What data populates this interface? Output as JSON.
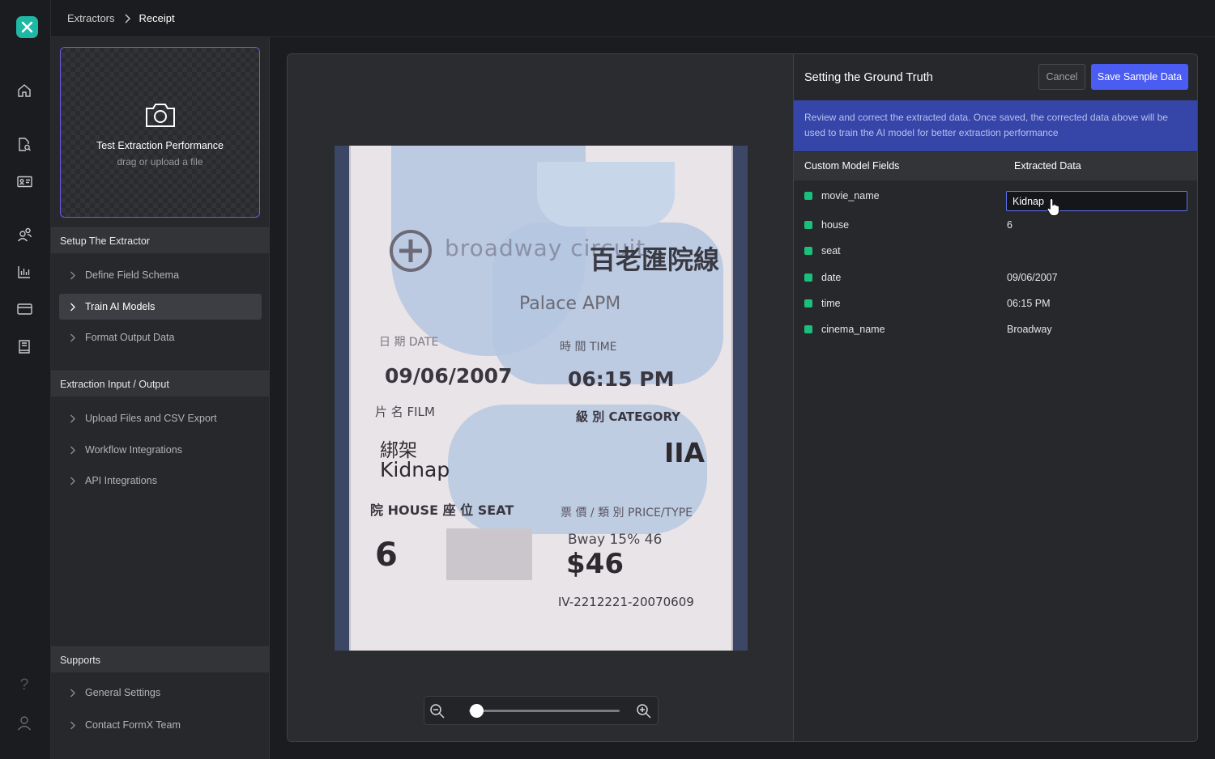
{
  "breadcrumb": {
    "parent": "Extractors",
    "current": "Receipt"
  },
  "rail": {
    "icons": [
      "home-icon",
      "document-search-icon",
      "id-card-icon",
      "users-icon",
      "bar-chart-icon",
      "credit-card-icon",
      "book-icon",
      "help-icon",
      "user-icon"
    ],
    "help_glyph": "?"
  },
  "upload": {
    "title": "Test Extraction Performance",
    "subtitle": "drag or upload a file"
  },
  "sidebar": {
    "setup": {
      "title": "Setup The Extractor",
      "items": [
        "Define Field Schema",
        "Train AI Models",
        "Format Output Data"
      ],
      "active": "Train AI Models"
    },
    "io": {
      "title": "Extraction Input / Output",
      "items": [
        "Upload Files and CSV Export",
        "Workflow Integrations",
        "API Integrations"
      ]
    },
    "supports": {
      "title": "Supports",
      "items": [
        "General Settings",
        "Contact FormX Team"
      ]
    }
  },
  "receipt": {
    "brand": "broadway circuit",
    "brand_cn": "百老匯院線",
    "cinema": "Palace APM",
    "date_label": "日 期 DATE",
    "date": "09/06/2007",
    "time_label": "時 間 TIME",
    "time": "06:15 PM",
    "film_label": "片 名 FILM",
    "film_cn": "綁架",
    "film": "Kidnap",
    "category_label": "級 別 CATEGORY",
    "category": "IIA",
    "house_label": "院 HOUSE 座 位 SEAT",
    "house": "6",
    "price_label": "票 價 / 類 別 PRICE/TYPE",
    "price_type": "Bway 15% 46",
    "price": "$46",
    "serial": "IV-2212221-20070609"
  },
  "zoom": {
    "level": 0.05
  },
  "ground_truth": {
    "title": "Setting the Ground Truth",
    "cancel_label": "Cancel",
    "save_label": "Save Sample Data",
    "info": "Review and correct the extracted data. Once saved, the corrected data above will be used to train the AI model for better extraction performance",
    "col_fields": "Custom Model Fields",
    "col_data": "Extracted Data",
    "rows": [
      {
        "field": "movie_name",
        "value": "Kidnap"
      },
      {
        "field": "house",
        "value": "6"
      },
      {
        "field": "seat",
        "value": ""
      },
      {
        "field": "date",
        "value": "09/06/2007"
      },
      {
        "field": "time",
        "value": "06:15 PM"
      },
      {
        "field": "cinema_name",
        "value": "Broadway"
      }
    ],
    "status_color": "#19c07a"
  },
  "colors": {
    "accent": "#4a5cf2",
    "brand": "#1fb8a6",
    "upload_border": "#6f5be6"
  }
}
